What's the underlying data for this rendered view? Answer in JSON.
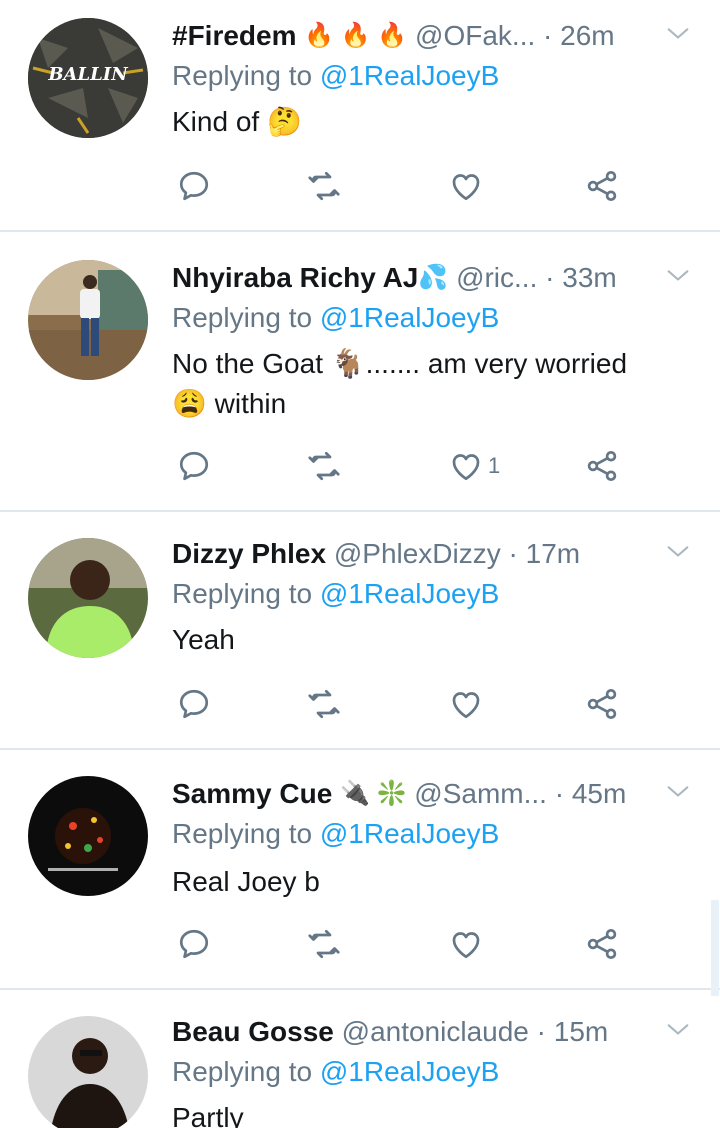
{
  "tweets": [
    {
      "name": "#Firedem",
      "badges": "🔥 🔥 🔥",
      "handle": "@OFak...",
      "time": "· 26m",
      "replying_prefix": "Replying to",
      "replying_to": "@1RealJoeyB",
      "text": "Kind of 🤔",
      "likes": "",
      "avatar_label": "BALLIN"
    },
    {
      "name": "Nhyiraba Richy AJ",
      "badges": "💦",
      "handle": "@ric...",
      "time": "· 33m",
      "replying_prefix": "Replying to",
      "replying_to": "@1RealJoeyB",
      "text": "No the Goat 🐐....... am very worried 😩 within",
      "likes": "1"
    },
    {
      "name": "Dizzy Phlex",
      "badges": "",
      "handle": "@PhlexDizzy",
      "time": "· 17m",
      "replying_prefix": "Replying to",
      "replying_to": "@1RealJoeyB",
      "text": "Yeah",
      "likes": ""
    },
    {
      "name": "Sammy Cue",
      "badges": "🔌 ❇️",
      "handle": "@Samm...",
      "time": "· 45m",
      "replying_prefix": "Replying to",
      "replying_to": "@1RealJoeyB",
      "text": "Real Joey b",
      "likes": ""
    },
    {
      "name": "Beau Gosse",
      "badges": "",
      "handle": "@antoniclaude",
      "time": "· 15m",
      "replying_prefix": "Replying to",
      "replying_to": "@1RealJoeyB",
      "text": "Partly",
      "likes": ""
    }
  ],
  "icons": {
    "reply": "reply-icon",
    "retweet": "retweet-icon",
    "like": "heart-icon",
    "share": "share-icon",
    "more": "chevron-down-icon"
  },
  "colors": {
    "text": "#14171a",
    "secondary": "#657786",
    "mention": "#1da1f2",
    "divider": "#e1e8ed"
  }
}
